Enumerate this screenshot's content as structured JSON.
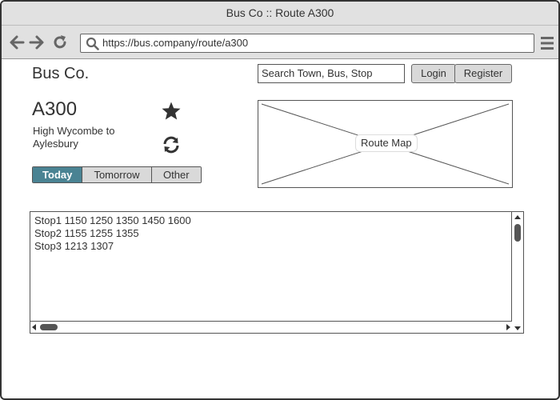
{
  "window": {
    "title": "Bus Co :: Route A300"
  },
  "browser": {
    "url": "https://bus.company/route/a300",
    "icons": [
      "back-icon",
      "forward-icon",
      "reload-icon",
      "search-icon",
      "menu-icon"
    ]
  },
  "header": {
    "brand": "Bus Co.",
    "search_placeholder": "Search Town, Bus, Stop",
    "login_label": "Login",
    "register_label": "Register"
  },
  "route": {
    "code": "A300",
    "description": "High Wycombe to Aylesbury",
    "favorite_icon": "star-icon",
    "refresh_icon": "refresh-icon"
  },
  "tabs": [
    {
      "label": "Today",
      "active": true
    },
    {
      "label": "Tomorrow",
      "active": false
    },
    {
      "label": "Other",
      "active": false
    }
  ],
  "map": {
    "label": "Route Map"
  },
  "timetable": {
    "rows": [
      {
        "stop": "Stop1",
        "times": "1150 1250 1350 1450 1600"
      },
      {
        "stop": "Stop2",
        "times": "1155 1255 1355"
      },
      {
        "stop": "Stop3",
        "times": "1213 1307"
      }
    ]
  },
  "colors": {
    "active_tab": "#4a8393",
    "chrome": "#e1e1e1",
    "button": "#d9d9d9"
  }
}
